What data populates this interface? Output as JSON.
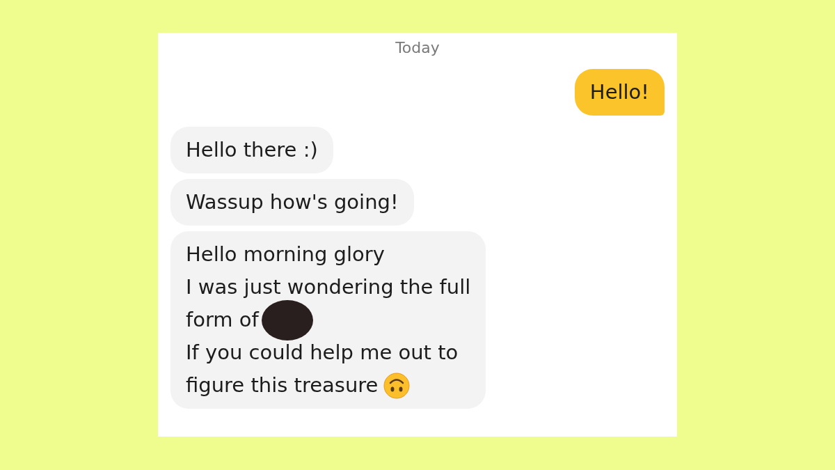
{
  "date_label": "Today",
  "messages": [
    {
      "kind": "outgoing",
      "lines": [
        {
          "text": "Hello!"
        }
      ]
    },
    {
      "kind": "incoming",
      "lines": [
        {
          "text": "Hello there :)"
        }
      ]
    },
    {
      "kind": "incoming",
      "lines": [
        {
          "text": "Wassup how's going!"
        }
      ]
    },
    {
      "kind": "incoming",
      "lines": [
        {
          "text": "Hello morning glory"
        },
        {
          "text": "I was just wondering the full"
        },
        {
          "text": "form of",
          "kind": "redaction"
        },
        {
          "text": "If you could help me out to"
        },
        {
          "text": "figure this treasure",
          "kind": "emoji"
        }
      ]
    }
  ]
}
